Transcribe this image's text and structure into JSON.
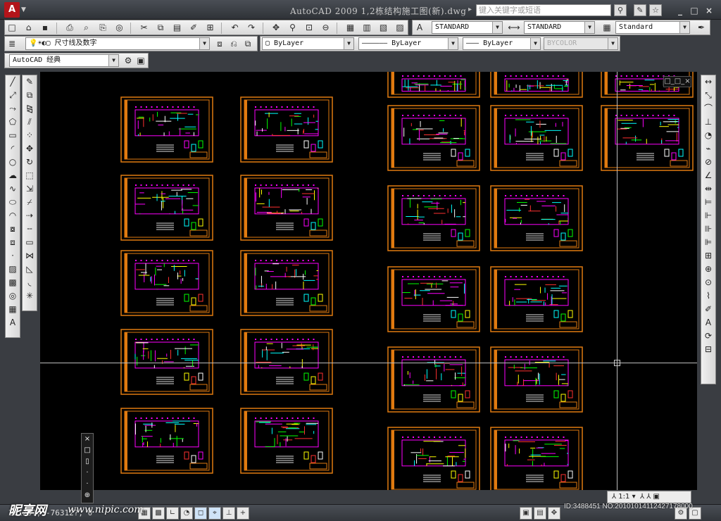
{
  "window": {
    "title": "AutoCAD 2009  1,2栋结构施工图(新).dwg",
    "search_placeholder": "键入关键字或短语",
    "logo": "A",
    "minimize": "_",
    "maximize": "□",
    "close": "×"
  },
  "toolbar": {
    "text_style": "STANDARD",
    "dim_style": "STANDARD",
    "table_style": "Standard",
    "layer_name": "尺寸线及数字",
    "color": "ByLayer",
    "linetype": "—————— ByLayer",
    "lineweight": "——— ByLayer",
    "plotstyle": "BYCOLOR",
    "workspace": "AutoCAD 经典"
  },
  "drawing": {
    "viewport_label": "□_□_×"
  },
  "floating_bar": {
    "items": [
      "×",
      "□",
      "▯",
      "·",
      "·",
      "⊕"
    ]
  },
  "status": {
    "coordinates": "28123?,  -76312?,  0",
    "scale": "1:1"
  },
  "watermark": {
    "brand": "昵享网",
    "url": "www.nipic.com",
    "id": "ID:3488451 NO:20101014112427178000"
  },
  "colors": {
    "sheet_border": "#e07a10",
    "canvas_bg": "#000000"
  }
}
